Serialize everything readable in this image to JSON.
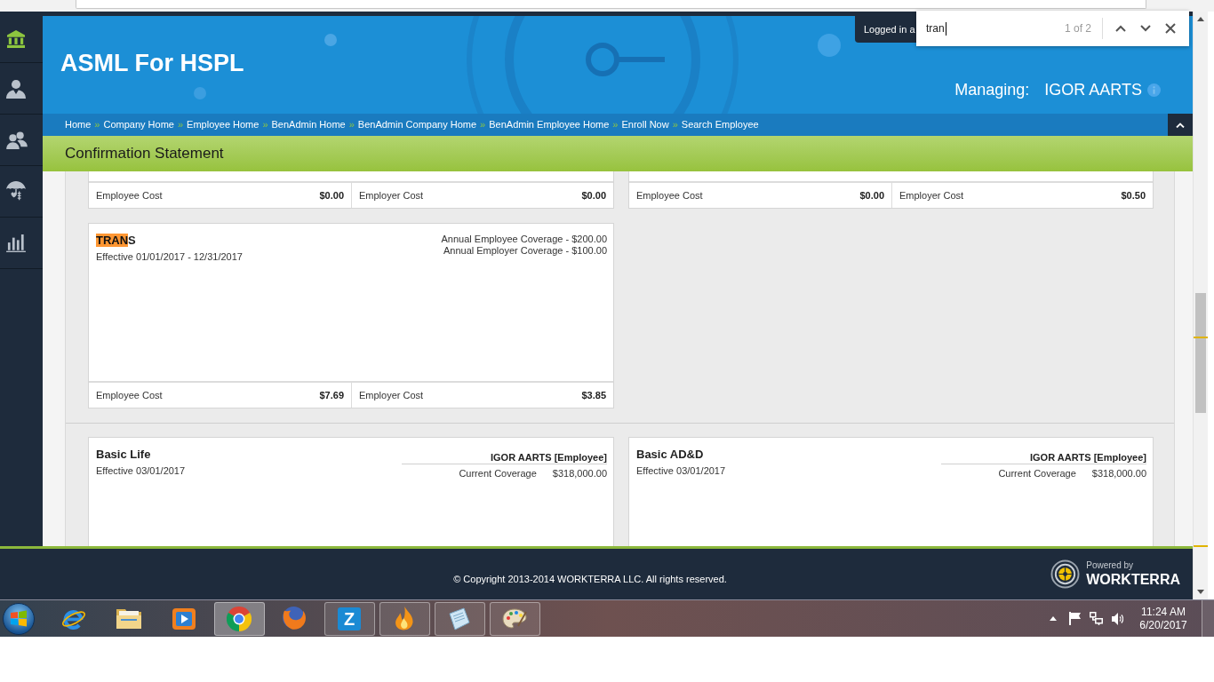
{
  "browser": {
    "find_bar": {
      "query": "tran",
      "match_count": "1 of 2"
    }
  },
  "sidebar": {
    "items": [
      {
        "selected": true
      },
      {
        "selected": false
      },
      {
        "selected": false
      },
      {
        "selected": false
      },
      {
        "selected": false
      }
    ]
  },
  "header": {
    "title": "ASML For HSPL",
    "logged_in_tab": "Logged in a",
    "managing_label": "Managing:",
    "managing_name": "IGOR AARTS"
  },
  "breadcrumbs": [
    {
      "label": "Home",
      "separator": "»"
    },
    {
      "label": "Company Home",
      "separator": "»"
    },
    {
      "label": "Employee Home",
      "separator": "»"
    },
    {
      "label": "BenAdmin Home",
      "separator": "»"
    },
    {
      "label": "BenAdmin Company Home",
      "separator": "»"
    },
    {
      "label": "BenAdmin Employee Home",
      "separator": "»"
    },
    {
      "label": "Enroll Now",
      "separator": "»"
    },
    {
      "label": "Search Employee"
    }
  ],
  "page_title": "Confirmation Statement",
  "sections": [
    {
      "cards": [
        {
          "kind": "partial",
          "costs": [
            {
              "label": "Employee Cost",
              "amount": "$0.00"
            },
            {
              "label": "Employer Cost",
              "amount": "$0.00"
            }
          ]
        },
        {
          "kind": "partial",
          "costs": [
            {
              "label": "Employee Cost",
              "amount": "$0.00"
            },
            {
              "label": "Employer Cost",
              "amount": "$0.50"
            }
          ]
        },
        {
          "kind": "plan",
          "title_segments": [
            {
              "text": "TRAN",
              "highlighted": true
            },
            {
              "text": "S",
              "highlighted": false
            }
          ],
          "effective": "Effective 01/01/2017 - 12/31/2017",
          "coverage_lines": [
            "Annual Employee Coverage - $200.00",
            "Annual Employer Coverage - $100.00"
          ],
          "costs": [
            {
              "label": "Employee Cost",
              "amount": "$7.69"
            },
            {
              "label": "Employer Cost",
              "amount": "$3.85"
            }
          ]
        }
      ]
    },
    {
      "cards": [
        {
          "kind": "plan",
          "title_segments": [
            {
              "text": "Basic Life",
              "highlighted": false
            }
          ],
          "effective": "Effective 03/01/2017",
          "member": "IGOR AARTS [Employee]",
          "coverage": {
            "label": "Current Coverage",
            "amount": "$318,000.00"
          }
        },
        {
          "kind": "plan",
          "title_segments": [
            {
              "text": "Basic AD&D",
              "highlighted": false
            }
          ],
          "effective": "Effective 03/01/2017",
          "member": "IGOR AARTS [Employee]",
          "coverage": {
            "label": "Current Coverage",
            "amount": "$318,000.00"
          }
        }
      ]
    }
  ],
  "footer": {
    "copyright": "© Copyright 2013-2014 WORKTERRA LLC. All rights reserved.",
    "logo": {
      "tagline": "Powered by",
      "name": "WORKTERRA"
    }
  },
  "taskbar": {
    "apps": [
      {
        "running": false,
        "selected": false
      },
      {
        "running": false,
        "selected": false
      },
      {
        "running": false,
        "selected": false
      },
      {
        "running": true,
        "selected": true
      },
      {
        "running": false,
        "selected": false
      },
      {
        "running": true,
        "selected": false,
        "letter": "Z"
      },
      {
        "running": true,
        "selected": false
      },
      {
        "running": true,
        "selected": false
      },
      {
        "running": true,
        "selected": false
      }
    ],
    "clock": {
      "time": "11:24 AM",
      "date": "6/20/2017"
    }
  }
}
